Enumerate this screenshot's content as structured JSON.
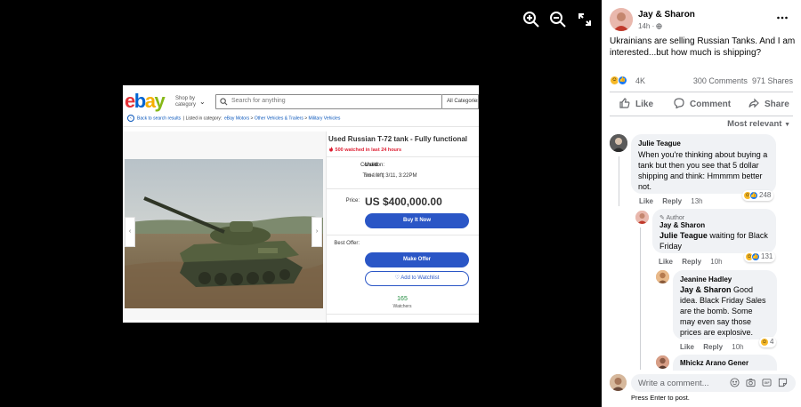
{
  "viewer": {
    "controls": [
      "zoom-in-icon",
      "zoom-out-icon",
      "fullscreen-icon"
    ]
  },
  "ebay": {
    "logo_letters": [
      "e",
      "b",
      "a",
      "y"
    ],
    "logo_colors": [
      "#e53238",
      "#0064d2",
      "#f5af02",
      "#86b817"
    ],
    "shop_by_line1": "Shop by",
    "shop_by_line2": "category",
    "search_placeholder": "Search for anything",
    "category_select": "All Categories",
    "back_link": "Back to search results",
    "listed_in": "Listed in category:",
    "crumbs": [
      "eBay Motors",
      "Other Vehicles & Trailers",
      "Military Vehicles"
    ],
    "crumb_sep": ">",
    "title": "Used Russian T-72 tank - Fully functional",
    "watched": "500 watched in last 24 hours",
    "condition_label": "Condition:",
    "condition_value": "Used",
    "time_left_label": "Time left:",
    "time_left_value": "9d 10h",
    "time_left_end": "3/11, 3:22PM",
    "price_label": "Price:",
    "price": "US $400,000.00",
    "buy_now": "Buy It Now",
    "best_offer_label": "Best Offer:",
    "make_offer": "Make Offer",
    "add_watchlist": "Add to Watchlist",
    "watchers_count": "165",
    "watchers_label": "Watchers"
  },
  "post": {
    "author": "Jay & Sharon",
    "time": "14h",
    "text": "Ukrainians are selling Russian Tanks. And I am interested...but how much is shipping?",
    "reaction_count": "4K",
    "comments_count": "300 Comments",
    "shares_count": "971 Shares",
    "actions": {
      "like": "Like",
      "comment": "Comment",
      "share": "Share"
    },
    "sort": "Most relevant"
  },
  "comments": [
    {
      "name": "Julie Teague",
      "text": "When you're thinking about buying a tank but then you see that 5 dollar shipping and think: Hmmmm better not.",
      "like": "Like",
      "reply": "Reply",
      "time": "13h",
      "reactions": "248"
    },
    {
      "badge": "Author",
      "name": "Jay & Sharon",
      "mention": "Julie Teague",
      "text": " waiting for Black Friday",
      "like": "Like",
      "reply": "Reply",
      "time": "10h",
      "reactions": "131"
    },
    {
      "name": "Jeanine Hadley",
      "mention": "Jay & Sharon",
      "text": " Good idea. Black Friday Sales are the bomb. Some may even say those prices are explosive.",
      "like": "Like",
      "reply": "Reply",
      "time": "10h",
      "reactions": "4"
    },
    {
      "name": "Mhickz Arano Gener"
    }
  ],
  "composer": {
    "placeholder": "Write a comment...",
    "hint": "Press Enter to post.",
    "icons": [
      "emoji-icon",
      "camera-icon",
      "gif-icon",
      "sticker-icon"
    ]
  }
}
